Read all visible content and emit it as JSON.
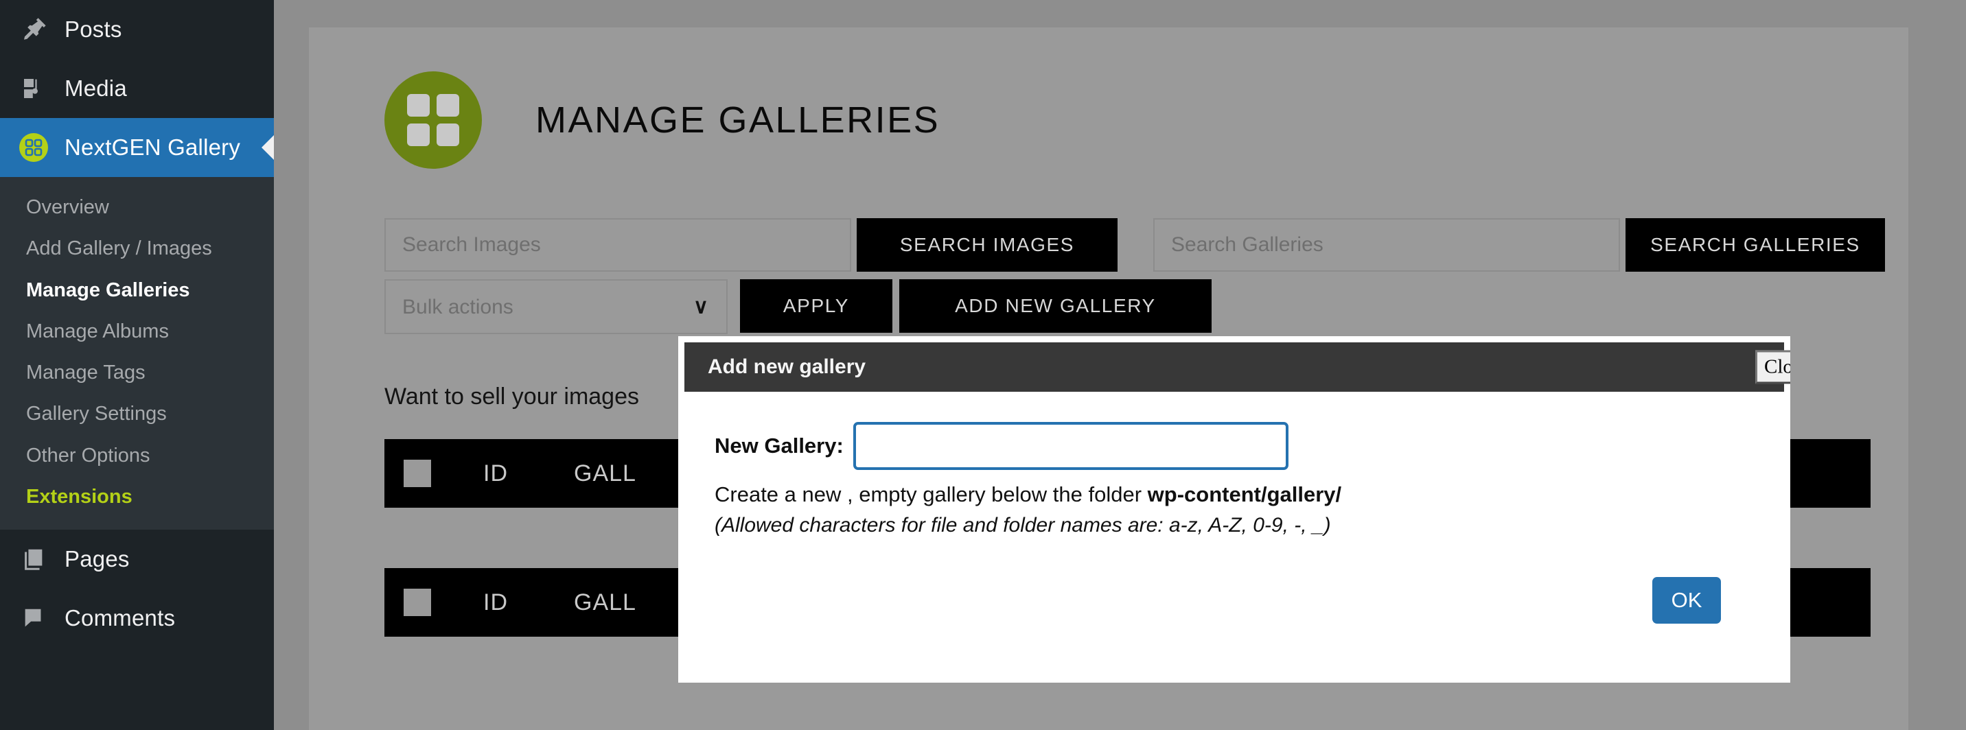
{
  "sidebar": {
    "top_items": [
      {
        "label": "Posts",
        "icon": "pin-icon",
        "active": false
      },
      {
        "label": "Media",
        "icon": "media-icon",
        "active": false
      },
      {
        "label": "NextGEN Gallery",
        "icon": "nextgen-gallery-icon",
        "active": true
      }
    ],
    "submenu": [
      {
        "label": "Overview",
        "state": "normal"
      },
      {
        "label": "Add Gallery / Images",
        "state": "normal"
      },
      {
        "label": "Manage Galleries",
        "state": "current"
      },
      {
        "label": "Manage Albums",
        "state": "normal"
      },
      {
        "label": "Manage Tags",
        "state": "normal"
      },
      {
        "label": "Gallery Settings",
        "state": "normal"
      },
      {
        "label": "Other Options",
        "state": "normal"
      },
      {
        "label": "Extensions",
        "state": "highlight"
      }
    ],
    "bottom_items": [
      {
        "label": "Pages",
        "icon": "pages-icon"
      },
      {
        "label": "Comments",
        "icon": "comments-icon"
      }
    ],
    "accent_active": "#2271b1",
    "accent_highlight": "#b4d117",
    "background": "#1d2327"
  },
  "header": {
    "title": "MANAGE GALLERIES",
    "logo_color": "#6a8313"
  },
  "toolbar": {
    "search_images_placeholder": "Search Images",
    "search_images_value": "",
    "search_images_button": "SEARCH IMAGES",
    "search_galleries_placeholder": "Search Galleries",
    "search_galleries_value": "",
    "search_galleries_button": "SEARCH GALLERIES",
    "bulk_actions_selected": "Bulk actions",
    "bulk_actions_options": [
      "Bulk actions"
    ],
    "apply_button": "APPLY",
    "add_new_gallery_button": "ADD NEW GALLERY",
    "chevron": "∨"
  },
  "notice": {
    "sell_text": "Want to sell your images"
  },
  "table": {
    "columns": [
      "ID",
      "GALL"
    ],
    "header_top": {
      "id": "ID",
      "gallery": "GALL"
    },
    "header_bottom": {
      "id": "ID",
      "gallery": "GALL"
    }
  },
  "modal": {
    "title": "Add new gallery",
    "close_button": "Close",
    "field_label": "New Gallery:",
    "field_value": "",
    "help_line_1_before": "Create a new , empty gallery below the folder ",
    "help_line_1_bold": "wp-content/gallery/",
    "help_line_2": "(Allowed characters for file and folder names are: a-z, A-Z, 0-9, -, _)",
    "ok_button": "OK",
    "accent": "#2572b0",
    "titlebar_color": "#383838"
  }
}
